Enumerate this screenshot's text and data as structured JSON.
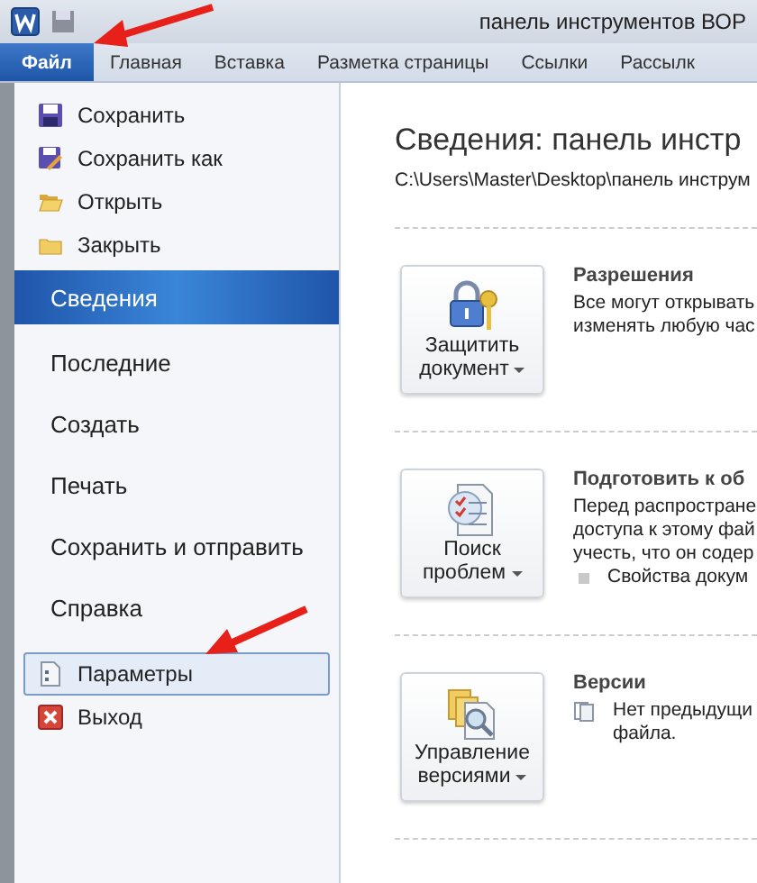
{
  "title_bar": {
    "title": "панель инструментов ВОР"
  },
  "tabs": [
    {
      "label": "Файл",
      "selected": true
    },
    {
      "label": "Главная",
      "selected": false
    },
    {
      "label": "Вставка",
      "selected": false
    },
    {
      "label": "Разметка страницы",
      "selected": false
    },
    {
      "label": "Ссылки",
      "selected": false
    },
    {
      "label": "Рассылк",
      "selected": false
    }
  ],
  "backstage_menu": [
    {
      "label": "Сохранить",
      "kind": "command",
      "selected": false,
      "hovered": false
    },
    {
      "label": "Сохранить как",
      "kind": "command",
      "selected": false,
      "hovered": false
    },
    {
      "label": "Открыть",
      "kind": "command",
      "selected": false,
      "hovered": false
    },
    {
      "label": "Закрыть",
      "kind": "command",
      "selected": false,
      "hovered": false
    },
    {
      "label": "Сведения",
      "kind": "page",
      "selected": true,
      "hovered": false
    },
    {
      "label": "Последние",
      "kind": "page",
      "selected": false,
      "hovered": false
    },
    {
      "label": "Создать",
      "kind": "page",
      "selected": false,
      "hovered": false
    },
    {
      "label": "Печать",
      "kind": "page",
      "selected": false,
      "hovered": false
    },
    {
      "label": "Сохранить и отправить",
      "kind": "page",
      "selected": false,
      "hovered": false
    },
    {
      "label": "Справка",
      "kind": "page",
      "selected": false,
      "hovered": false
    },
    {
      "label": "Параметры",
      "kind": "command",
      "selected": false,
      "hovered": true
    },
    {
      "label": "Выход",
      "kind": "command",
      "selected": false,
      "hovered": false
    }
  ],
  "content": {
    "heading": "Сведения: панель инстр",
    "path": "C:\\Users\\Master\\Desktop\\панель инструм",
    "sections": [
      {
        "button": [
          "Защитить",
          "документ"
        ],
        "title": "Разрешения",
        "lines": [
          {
            "kind": "text",
            "text": "Все могут открывать"
          },
          {
            "kind": "text",
            "text": "изменять любую час"
          }
        ]
      },
      {
        "button": [
          "Поиск",
          "проблем"
        ],
        "title": "Подготовить к об",
        "lines": [
          {
            "kind": "text",
            "text": "Перед распростране"
          },
          {
            "kind": "text",
            "text": "доступа к этому фай"
          },
          {
            "kind": "text",
            "text": "учесть, что он содер"
          },
          {
            "kind": "bullet",
            "text": "Свойства докум"
          }
        ]
      },
      {
        "button": [
          "Управление",
          "версиями"
        ],
        "title": "Версии",
        "lines": [
          {
            "kind": "icon",
            "text": "Нет предыдущи"
          },
          {
            "kind": "indent",
            "text": "файла."
          }
        ]
      }
    ]
  }
}
